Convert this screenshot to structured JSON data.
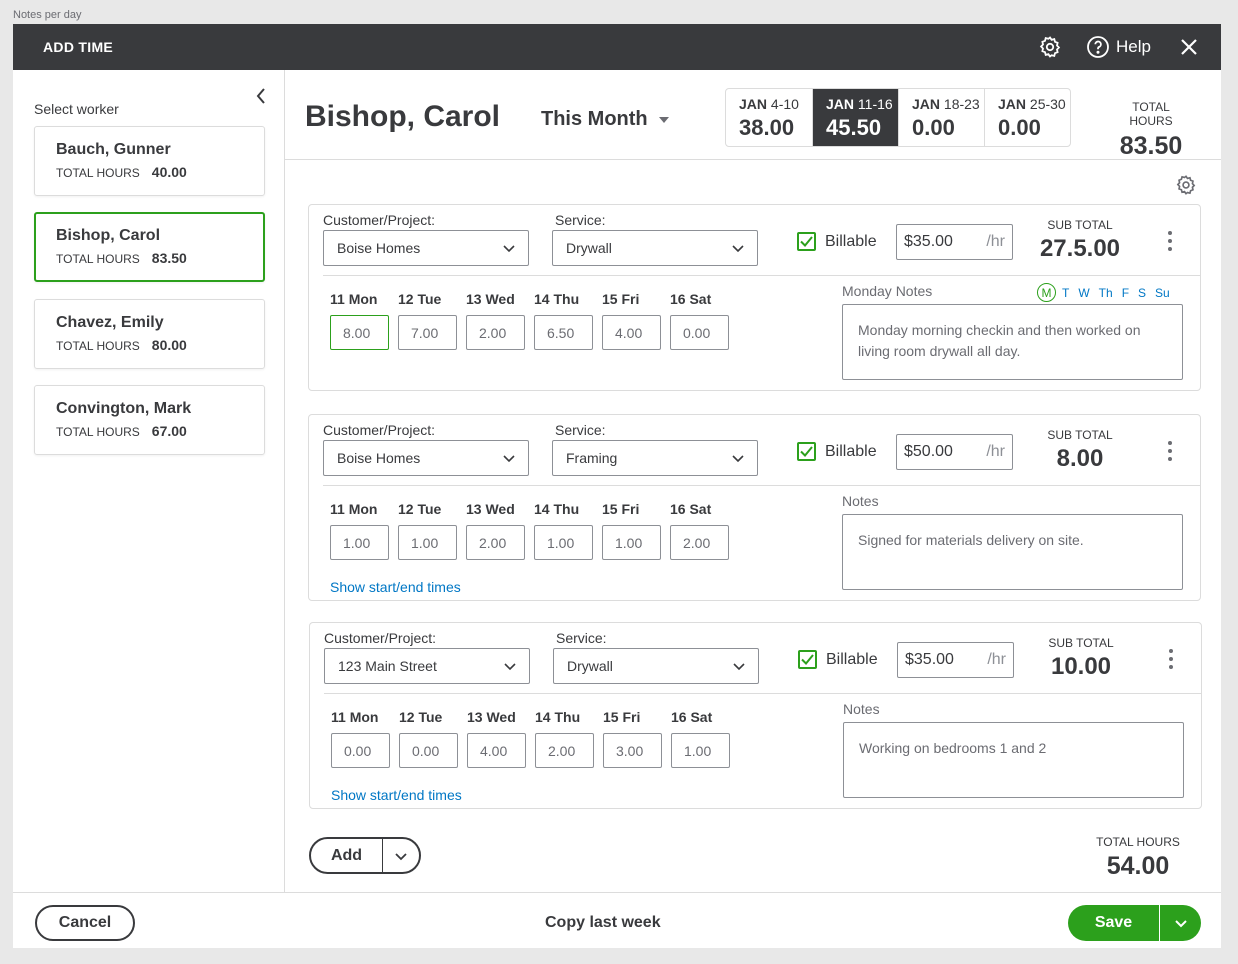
{
  "caption": "Notes per day",
  "topbar": {
    "title": "ADD TIME",
    "help": "Help"
  },
  "sidebar": {
    "label": "Select worker",
    "total_label": "TOTAL HOURS",
    "workers": [
      {
        "name": "Bauch, Gunner",
        "hours": "40.00"
      },
      {
        "name": "Bishop, Carol",
        "hours": "83.50"
      },
      {
        "name": "Chavez, Emily",
        "hours": "80.00"
      },
      {
        "name": "Convington, Mark",
        "hours": "67.00"
      }
    ]
  },
  "header": {
    "name": "Bishop, Carol",
    "range": "This Month",
    "weeks": [
      {
        "month": "JAN",
        "days": "4-10",
        "hours": "38.00"
      },
      {
        "month": "JAN",
        "days": "11-16",
        "hours": "45.50"
      },
      {
        "month": "JAN",
        "days": "18-23",
        "hours": "0.00"
      },
      {
        "month": "JAN",
        "days": "25-30",
        "hours": "0.00"
      }
    ],
    "total_label": "TOTAL HOURS",
    "total": "83.50"
  },
  "labels": {
    "customer": "Customer/Project:",
    "service": "Service:",
    "billable": "Billable",
    "per_hr": "/hr",
    "subtotal": "SUB TOTAL",
    "show_times": "Show start/end times"
  },
  "day_labels": [
    {
      "num": "11",
      "name": "Mon"
    },
    {
      "num": "12",
      "name": "Tue"
    },
    {
      "num": "13",
      "name": "Wed"
    },
    {
      "num": "14",
      "name": "Thu"
    },
    {
      "num": "15",
      "name": "Fri"
    },
    {
      "num": "16",
      "name": "Sat"
    }
  ],
  "dow_picker": [
    "M",
    "T",
    "W",
    "Th",
    "F",
    "S",
    "Su"
  ],
  "entries": [
    {
      "customer": "Boise Homes",
      "service": "Drywall",
      "rate": "$35.00",
      "subtotal": "27.5.00",
      "hours": [
        "8.00",
        "7.00",
        "2.00",
        "6.50",
        "4.00",
        "0.00"
      ],
      "notes_label": "Monday Notes",
      "notes": "Monday morning checkin and then worked on living room drywall all day."
    },
    {
      "customer": "Boise Homes",
      "service": "Framing",
      "rate": "$50.00",
      "subtotal": "8.00",
      "hours": [
        "1.00",
        "1.00",
        "2.00",
        "1.00",
        "1.00",
        "2.00"
      ],
      "notes_label": "Notes",
      "notes": "Signed for materials delivery on site."
    },
    {
      "customer": "123 Main Street",
      "service": "Drywall",
      "rate": "$35.00",
      "subtotal": "10.00",
      "hours": [
        "0.00",
        "0.00",
        "4.00",
        "2.00",
        "3.00",
        "1.00"
      ],
      "notes_label": "Notes",
      "notes": "Working on bedrooms 1 and 2"
    }
  ],
  "add_label": "Add",
  "grand_total_label": "TOTAL HOURS",
  "grand_total": "54.00",
  "footer": {
    "cancel": "Cancel",
    "copy": "Copy last week",
    "save": "Save"
  },
  "colors": {
    "accent": "#2ca01c",
    "link": "#0077c5",
    "dark": "#393a3d"
  }
}
